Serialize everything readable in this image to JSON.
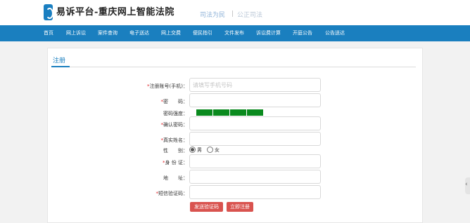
{
  "header": {
    "title": "易诉平台-重庆网上智能法院",
    "slogan_left": "司法为民",
    "slogan_right": "公正司法"
  },
  "nav": {
    "items": [
      "首页",
      "网上诉讼",
      "案件查询",
      "电子送达",
      "网上交费",
      "便民指引",
      "文件发布",
      "诉讼费计算",
      "开庭公告",
      "公告送达"
    ]
  },
  "form": {
    "title": "注册",
    "required_mark": "*",
    "account_label": "注册账号(手机)：",
    "account_placeholder": "请填写手机号码",
    "password_label": "密　　码：",
    "strength_label": "密码强度：",
    "strength_level": 4,
    "strength_max": 4,
    "confirm_label": "确认密码：",
    "realname_label": "真实姓名：",
    "gender_label": "性　　别：",
    "gender_options": [
      "男",
      "女"
    ],
    "gender_selected": "男",
    "idcard_label": "身 份 证：",
    "address_label": "地　　址：",
    "sms_label": "短信验证码：",
    "send_code_button": "发送验证码",
    "register_button": "立即注册"
  },
  "colors": {
    "nav_bg": "#1a7fbf",
    "accent": "#1a7fbf",
    "required": "#e0262a",
    "strength": "#0a8a1e",
    "button": "#d9534f"
  }
}
